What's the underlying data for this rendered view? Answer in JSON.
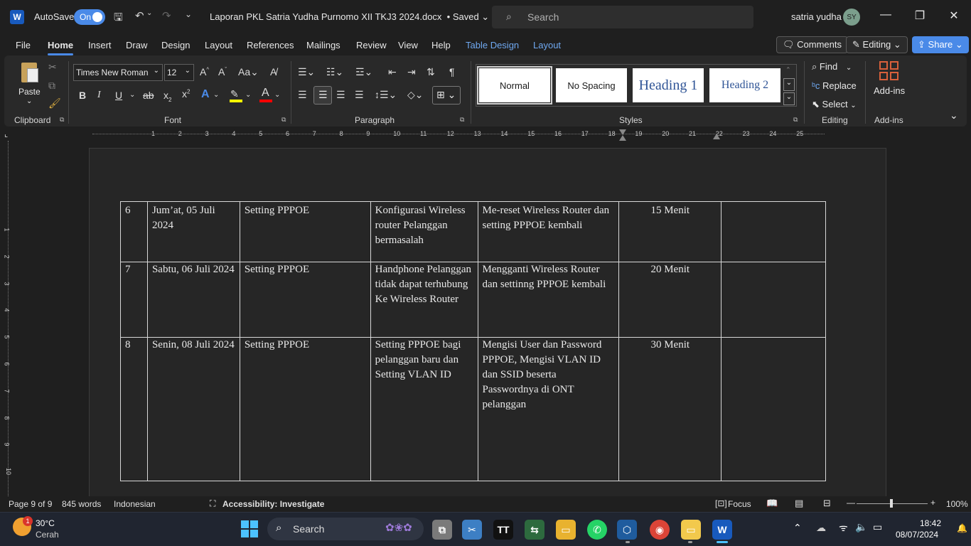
{
  "titlebar": {
    "app_letter": "W",
    "autosave_label": "AutoSave",
    "autosave_state": "On",
    "document_title": "Laporan PKL Satria Yudha Purnomo XII TKJ3 2024.docx",
    "save_status": "• Saved",
    "search_placeholder": "Search",
    "user_name": "satria yudha",
    "user_initials": "SY",
    "icons": [
      "save-icon",
      "undo-icon",
      "redo-icon",
      "customize-icon",
      "search-icon",
      "minimize-icon",
      "restore-icon",
      "close-icon"
    ]
  },
  "tabs": [
    "File",
    "Home",
    "Insert",
    "Draw",
    "Design",
    "Layout",
    "References",
    "Mailings",
    "Review",
    "View",
    "Help"
  ],
  "context_tabs": [
    "Table Design",
    "Layout"
  ],
  "active_tab": "Home",
  "header_buttons": {
    "comments": "Comments",
    "editing": "Editing",
    "share": "Share"
  },
  "ribbon": {
    "clipboard": {
      "paste": "Paste",
      "label": "Clipboard"
    },
    "font": {
      "name": "Times New Roman",
      "size": "12",
      "label": "Font"
    },
    "paragraph": {
      "label": "Paragraph"
    },
    "styles": {
      "items": [
        "Normal",
        "No Spacing",
        "Heading 1",
        "Heading 2"
      ],
      "label": "Styles"
    },
    "editing": {
      "find": "Find",
      "replace": "Replace",
      "select": "Select",
      "label": "Editing"
    },
    "addins": {
      "button": "Add-ins",
      "label": "Add-ins"
    }
  },
  "ruler_numbers": [
    "1",
    "2",
    "3",
    "4",
    "5",
    "6",
    "7",
    "8",
    "9",
    "10",
    "11",
    "12",
    "13",
    "14",
    "15",
    "16",
    "17",
    "18",
    "19",
    "20",
    "21",
    "22",
    "23",
    "24",
    "25"
  ],
  "table_rows": [
    {
      "no": "6",
      "date": "Jum’at, 05 Juli 2024",
      "activity": "Setting PPPOE",
      "problem": "Konfigurasi Wireless router Pelanggan bermasalah",
      "solution": "Me-reset Wireless Router dan setting PPPOE kembali",
      "duration": "15 Menit",
      "note": ""
    },
    {
      "no": "7",
      "date": "Sabtu, 06 Juli 2024",
      "activity": "Setting PPPOE",
      "problem": "Handphone Pelanggan tidak dapat terhubung Ke Wireless Router",
      "solution": "Mengganti Wireless Router dan settinng PPPOE kembali",
      "duration": "20 Menit",
      "note": ""
    },
    {
      "no": "8",
      "date": "Senin, 08 Juli 2024",
      "activity": "Setting PPPOE",
      "problem": "Setting PPPOE bagi pelanggan baru dan Setting VLAN ID",
      "solution": "Mengisi User dan Password PPPOE, Mengisi VLAN ID dan SSID beserta Passwordnya di ONT pelanggan",
      "duration": "30 Menit",
      "note": ""
    }
  ],
  "status": {
    "page": "Page 9 of 9",
    "words": "845 words",
    "language": "Indonesian",
    "accessibility": "Accessibility: Investigate",
    "focus": "Focus",
    "zoom": "100%"
  },
  "taskbar": {
    "weather_temp": "30°C",
    "weather_desc": "Cerah",
    "weather_badge": "1",
    "search_label": "Search",
    "time": "18:42",
    "date": "08/07/2024"
  },
  "colors": {
    "accent": "#4a8ae8",
    "word_blue": "#185abd",
    "context_tab": "#6fa8f0"
  }
}
